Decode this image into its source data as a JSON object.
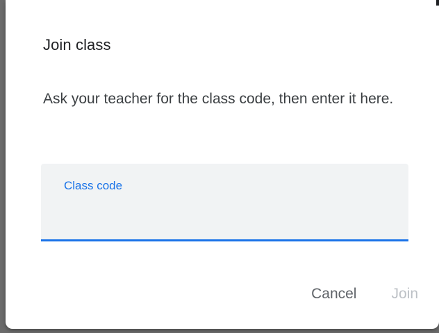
{
  "dialog": {
    "title": "Join class",
    "message": "Ask your teacher for the class code, then enter it here.",
    "field": {
      "label": "Class code",
      "value": "",
      "accent_color": "#1a73e8"
    },
    "actions": {
      "cancel_label": "Cancel",
      "join_label": "Join",
      "join_disabled": true
    }
  }
}
